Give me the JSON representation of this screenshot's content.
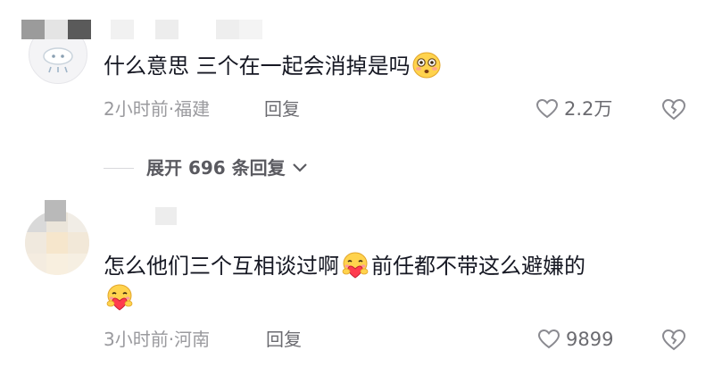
{
  "comments": [
    {
      "text": "什么意思 三个在一起会消掉是吗",
      "time_location": "2小时前·福建",
      "reply_label": "回复",
      "like_count": "2.2万",
      "emoji": "flushed-face"
    },
    {
      "text_before": "怎么他们三个互相谈过啊",
      "text_after": "前任都不带这么避嫌的",
      "time_location": "3小时前·河南",
      "reply_label": "回复",
      "like_count": "9899",
      "emoji": "heart-hug-face"
    }
  ],
  "expand_replies": {
    "label": "展开 696 条回复"
  },
  "colors": {
    "text": "#161823",
    "meta": "#9a9a9e",
    "icon": "#6b6b70"
  }
}
